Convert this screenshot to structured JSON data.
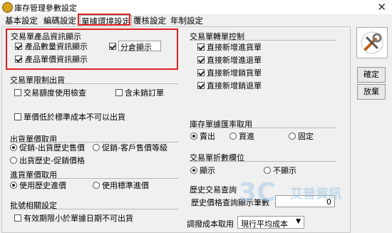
{
  "window": {
    "title": "庫存管理參數設定",
    "close_glyph": "✕"
  },
  "tabs": [
    "基本設定",
    "編碼設定",
    "單據環境設定",
    "覆核設定",
    "年制設定"
  ],
  "left": {
    "product_info": {
      "title": "交易單產品資訊顯示",
      "qty_info": {
        "label": "產品數量資訊顯示",
        "checked": true
      },
      "warehouse": {
        "label": "分倉顯示",
        "checked": true
      },
      "price_info": {
        "label": "產品單價資訊顯示",
        "checked": true
      }
    },
    "shipment_limit": {
      "title": "交易單限制出貨",
      "credit_check": {
        "label": "交易額度使用檢查",
        "checked": false
      },
      "incl_unsold": {
        "label": "含未銷訂單",
        "checked": false
      },
      "below_cost": {
        "label": "單價低於標準成本不可以出貨",
        "checked": false
      }
    },
    "ship_price": {
      "title": "出貨單價取用",
      "options": [
        "促銷-出貨歷史售價",
        "促銷-客戶售價等級",
        "出貨歷史-促銷價格"
      ],
      "selected": 0
    },
    "purchase_price": {
      "title": "進貨單價取用",
      "options": [
        "使用歷史進價",
        "使用標準進價"
      ],
      "selected": 0
    },
    "batch": {
      "title": "批號相關設定",
      "expiry": {
        "label": "有效期限小於單據日期不可出貨",
        "checked": false
      }
    }
  },
  "right": {
    "transfer": {
      "title": "交易單轉單控制",
      "items": [
        {
          "label": "直接新增進貨單",
          "checked": true
        },
        {
          "label": "直接新增進退單",
          "checked": true
        },
        {
          "label": "直接新增銷貨單",
          "checked": true
        },
        {
          "label": "直接新增銷退單",
          "checked": true
        }
      ]
    },
    "rate": {
      "title": "庫存單據匯率取用",
      "options": [
        "賣出",
        "買進",
        "固定"
      ],
      "selected": 0
    },
    "discount": {
      "title": "交易單折數欄位",
      "options": [
        "顯示",
        "不顯示"
      ],
      "selected": 0
    },
    "history": {
      "title": "歷史交易查詢",
      "count_label": "歷史價格查詢顯示筆數",
      "count_value": "0"
    },
    "cost": {
      "label": "調撥成本取用",
      "value": "現行平均成本"
    }
  },
  "buttons": {
    "ok": "確定",
    "cancel": "放棄"
  },
  "watermark": {
    "text": "艾普資訊"
  },
  "colors": {
    "highlight": "#e02020",
    "background": "#f0f0f0"
  }
}
